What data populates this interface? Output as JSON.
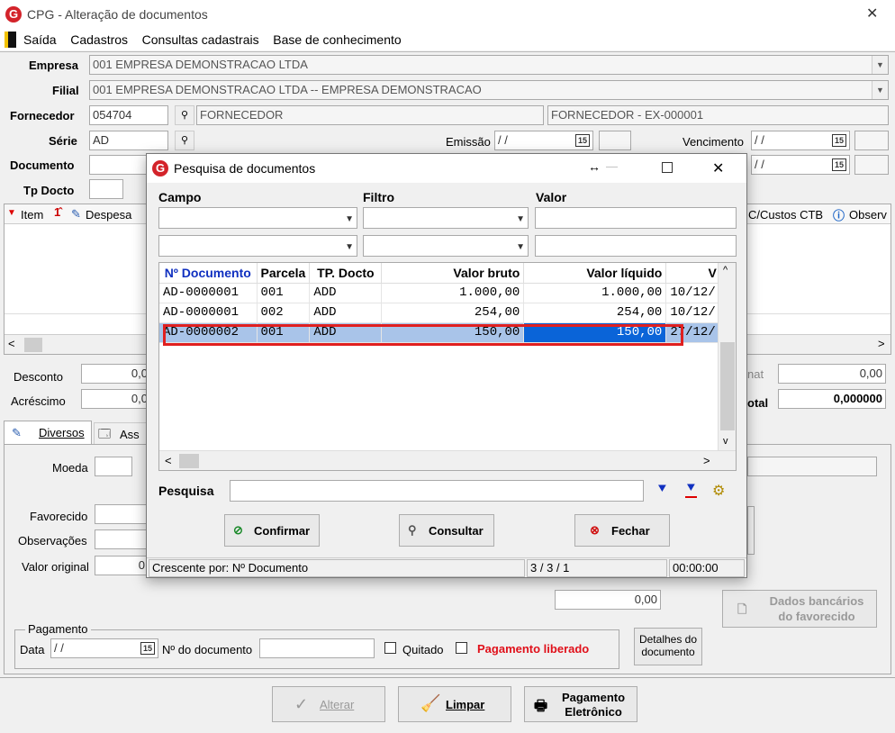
{
  "window": {
    "title": "CPG - Alteração de documentos",
    "close": "✕"
  },
  "menu": [
    "Saída",
    "Cadastros",
    "Consultas cadastrais",
    "Base de conhecimento"
  ],
  "form": {
    "empresa_label": "Empresa",
    "empresa_value": "001 EMPRESA DEMONSTRACAO LTDA",
    "filial_label": "Filial",
    "filial_value": "001 EMPRESA DEMONSTRACAO LTDA -- EMPRESA DEMONSTRACAO",
    "fornecedor_label": "Fornecedor",
    "fornecedor_code": "054704",
    "fornecedor_name": "FORNECEDOR",
    "fornecedor_ext": "FORNECEDOR - EX-000001",
    "serie_label": "Série",
    "serie_value": "AD",
    "emissao_label": "Emissão",
    "emissao_value": " / /",
    "vencimento_label": "Vencimento",
    "vencimento_value": " / /",
    "documento_label": "Documento",
    "tpdocto_label": "Tp Docto",
    "date2_value": " / /"
  },
  "items_header": {
    "item": "Item",
    "despesa": "Despesa",
    "cc": "C/Custos CTB",
    "obs": "Observ"
  },
  "totals": {
    "desconto_label": "Desconto",
    "desconto_value": "0,0",
    "acrescimo_label": "Acréscimo",
    "acrescimo_value": "0,0",
    "right1_label": "nat",
    "right1_value": "0,00",
    "total_label": "otal",
    "total_value": "0,000000"
  },
  "tabs": {
    "diversos": "Diversos",
    "ass": "Ass"
  },
  "tab_fields": {
    "moeda": "Moeda",
    "favorecido": "Favorecido",
    "observacoes": "Observações",
    "valor_original": "Valor original",
    "valor_original_value": "0",
    "amount_value": "0,00",
    "dados_bancarios": "Dados bancários",
    "do_favorecido": "do favorecido"
  },
  "pagamento": {
    "group": "Pagamento",
    "data_label": "Data",
    "data_value": " / /",
    "ndoc_label": "Nº do documento",
    "quitado": "Quitado",
    "liberado": "Pagamento liberado",
    "detalhes1": "Detalhes do",
    "detalhes2": "documento"
  },
  "bottom_buttons": {
    "alterar": "Alterar",
    "limpar": "Limpar",
    "pagamento1": "Pagamento",
    "pagamento2": "Eletrônico"
  },
  "dialog": {
    "title": "Pesquisa de documentos",
    "filter_headers": {
      "campo": "Campo",
      "filtro": "Filtro",
      "valor": "Valor"
    },
    "columns": [
      "Nº Documento",
      "Parcela",
      "TP. Docto",
      "Valor bruto",
      "Valor líquido",
      "V"
    ],
    "rows": [
      {
        "doc": "AD-0000001",
        "parcela": "001",
        "tp": "ADD",
        "bruto": "1.000,00",
        "liquido": "1.000,00",
        "venc": "10/12/"
      },
      {
        "doc": "AD-0000001",
        "parcela": "002",
        "tp": "ADD",
        "bruto": "254,00",
        "liquido": "254,00",
        "venc": "10/12/"
      },
      {
        "doc": "AD-0000002",
        "parcela": "001",
        "tp": "ADD",
        "bruto": "150,00",
        "liquido": "150,00",
        "venc": "27/12/"
      }
    ],
    "pesquisa_label": "Pesquisa",
    "btn_confirmar": "Confirmar",
    "btn_consultar": "Consultar",
    "btn_fechar": "Fechar",
    "status_order": "Crescente por: Nº Documento",
    "status_count": "3 / 3 / 1",
    "status_time": "00:00:00",
    "highlight_color": "#e02020"
  }
}
